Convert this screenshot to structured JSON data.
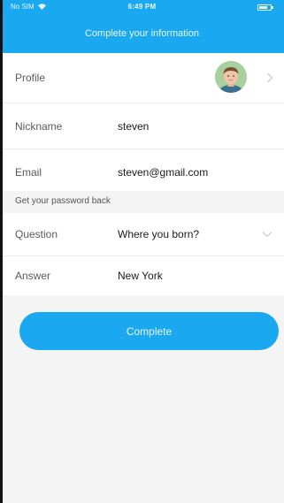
{
  "status_bar": {
    "carrier": "No SIM",
    "time": "6:49 PM",
    "wifi_icon": "wifi-icon",
    "battery_icon": "battery-icon"
  },
  "header": {
    "title": "Complete your information",
    "background_color": "#1aa8f0"
  },
  "profile_section": {
    "profile": {
      "label": "Profile",
      "avatar_icon": "avatar",
      "chevron_icon": "chevron-right-icon"
    },
    "nickname": {
      "label": "Nickname",
      "value": "steven"
    },
    "email": {
      "label": "Email",
      "value": "steven@gmail.com"
    }
  },
  "password_section": {
    "header": "Get your password back",
    "question": {
      "label": "Question",
      "value": "Where you born?",
      "chevron_icon": "chevron-down-icon"
    },
    "answer": {
      "label": "Answer",
      "value": "New York"
    }
  },
  "complete_button": {
    "label": "Complete",
    "color": "#1aa8f0"
  }
}
